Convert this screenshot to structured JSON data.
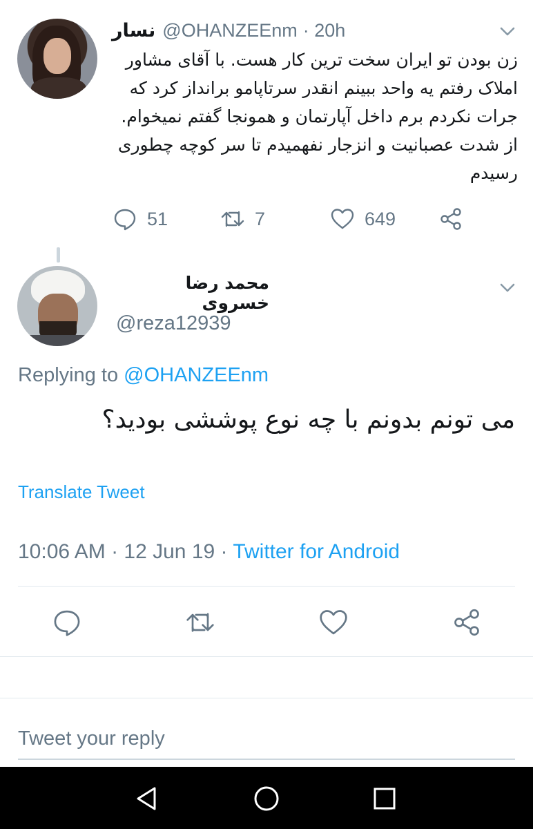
{
  "parent_tweet": {
    "display_name": "نسار",
    "handle": "@OHANZEEnm",
    "time": "· 20h",
    "text": "زن بودن تو ایران سخت ترین کار هست. با آقای مشاور املاک رفتم یه واحد ببینم انقدر سرتاپامو برانداز کرد که جرات نکردم برم داخل آپارتمان و همونجا گفتم نمیخوام. از شدت عصبانیت و انزجار نفهمیدم تا سر کوچه چطوری رسیدم",
    "replies": "51",
    "retweets": "7",
    "likes": "649",
    "menu_icon": "chevron-down-icon"
  },
  "main_tweet": {
    "display_name": "محمد رضا خسروی",
    "handle": "@reza12939",
    "replying_prefix": "Replying to ",
    "replying_to": "@OHANZEEnm",
    "text": "می تونم بدونم با چه نوع پوششی بودید؟",
    "translate_label": "Translate Tweet",
    "timestamp": "10:06 AM · 12 Jun 19 · ",
    "source": "Twitter for Android",
    "menu_icon": "chevron-down-icon"
  },
  "reply_box": {
    "placeholder": "Tweet your reply"
  },
  "colors": {
    "link": "#1da1f2",
    "secondary_text": "#657786",
    "divider": "#e1e8ed",
    "nav_bar": "#000000"
  },
  "icons": {
    "reply": "speech-bubble-icon",
    "retweet": "retweet-icon",
    "like": "heart-icon",
    "share": "share-icon",
    "nav_back": "triangle-back-icon",
    "nav_home": "circle-home-icon",
    "nav_recents": "square-recents-icon"
  }
}
